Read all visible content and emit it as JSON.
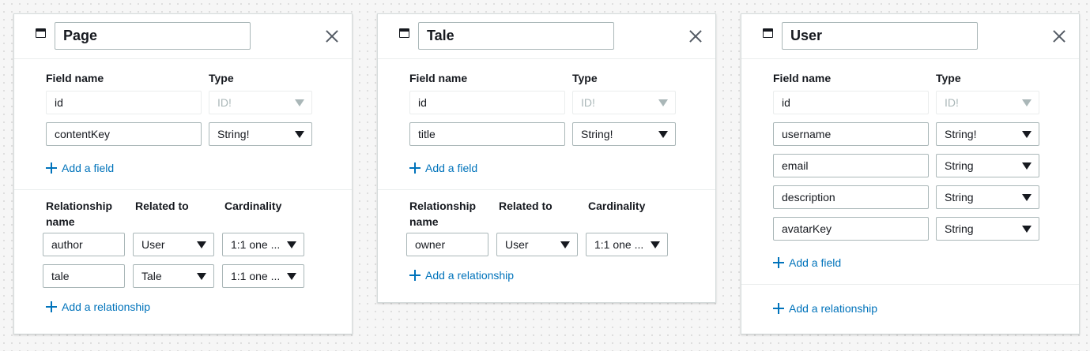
{
  "labels": {
    "field_name": "Field name",
    "type": "Type",
    "relationship_name": "Relationship\nname",
    "related_to": "Related to",
    "cardinality": "Cardinality",
    "add_field": "Add a field",
    "add_relationship": "Add a relationship"
  },
  "models": [
    {
      "name": "Page",
      "fields": [
        {
          "name": "id",
          "type": "ID!",
          "locked": true
        },
        {
          "name": "contentKey",
          "type": "String!",
          "locked": false
        }
      ],
      "relationships": [
        {
          "name": "author",
          "related_to": "User",
          "cardinality": "1:1 one ..."
        },
        {
          "name": "tale",
          "related_to": "Tale",
          "cardinality": "1:1 one ..."
        }
      ]
    },
    {
      "name": "Tale",
      "fields": [
        {
          "name": "id",
          "type": "ID!",
          "locked": true
        },
        {
          "name": "title",
          "type": "String!",
          "locked": false
        }
      ],
      "relationships": [
        {
          "name": "owner",
          "related_to": "User",
          "cardinality": "1:1 one ..."
        }
      ]
    },
    {
      "name": "User",
      "fields": [
        {
          "name": "id",
          "type": "ID!",
          "locked": true
        },
        {
          "name": "username",
          "type": "String!",
          "locked": false
        },
        {
          "name": "email",
          "type": "String",
          "locked": false
        },
        {
          "name": "description",
          "type": "String",
          "locked": false
        },
        {
          "name": "avatarKey",
          "type": "String",
          "locked": false
        }
      ],
      "relationships": []
    }
  ],
  "colors": {
    "link": "#0073bb",
    "border": "#aab7b8",
    "disabled_text": "#aab7b8",
    "text": "#16191f"
  }
}
